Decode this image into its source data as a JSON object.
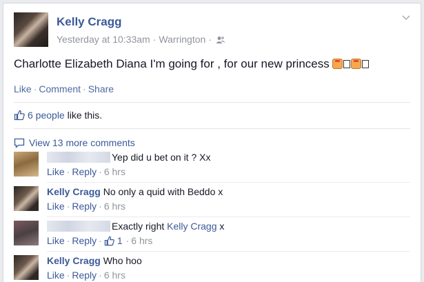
{
  "post": {
    "author": "Kelly Cragg",
    "time": "Yesterday at 10:33am",
    "location": "Warrington",
    "audience_icon": "friends-icon",
    "text_before": "Charlotte Elizabeth Diana I'm going for , for our new princess",
    "actions": {
      "like": "Like",
      "comment": "Comment",
      "share": "Share"
    }
  },
  "likes": {
    "count_text": "6 people",
    "suffix": "like this."
  },
  "view_more": "View 13 more comments",
  "comments": [
    {
      "author": "",
      "text": "Yep did u bet on it ? Xx",
      "like": "Like",
      "reply": "Reply",
      "time": "6 hrs"
    },
    {
      "author": "Kelly Cragg",
      "text": "No only a quid with Beddo x",
      "like": "Like",
      "reply": "Reply",
      "time": "6 hrs"
    },
    {
      "author": "",
      "text": "Exactly right",
      "mention": "Kelly Cragg",
      "text_after": "x",
      "like": "Like",
      "reply": "Reply",
      "like_count": "1",
      "time": "6 hrs"
    },
    {
      "author": "Kelly Cragg",
      "text": "Who hoo",
      "like": "Like",
      "reply": "Reply",
      "time": "6 hrs"
    }
  ],
  "colors": {
    "link": "#3b5998",
    "meta": "#90949c",
    "background": "#e9ebee"
  }
}
